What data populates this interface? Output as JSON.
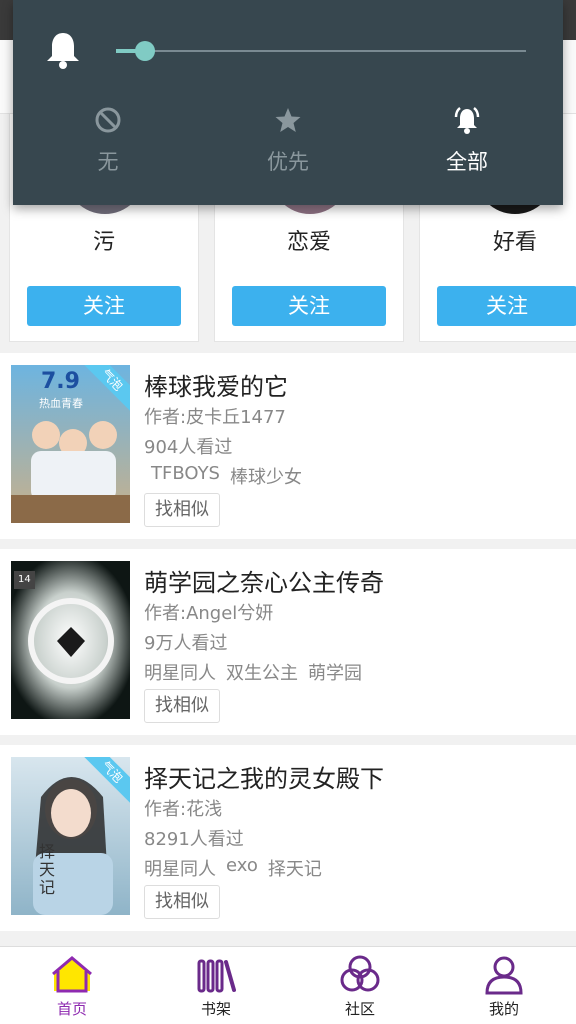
{
  "notification_mode": {
    "volume_fraction": 0.07,
    "options": [
      {
        "label": "无",
        "icon": "block-icon",
        "selected": false
      },
      {
        "label": "优先",
        "icon": "star-icon",
        "selected": false
      },
      {
        "label": "全部",
        "icon": "bell-ring-icon",
        "selected": true
      }
    ]
  },
  "tags": [
    {
      "name": "污",
      "follow_label": "关注"
    },
    {
      "name": "恋爱",
      "follow_label": "关注"
    },
    {
      "name": "好看",
      "follow_label": "关注"
    }
  ],
  "books": [
    {
      "title": "棒球我爱的它",
      "author": "作者:皮卡丘1477",
      "views": "904人看过",
      "tags": [
        "TFBOYS",
        "棒球少女"
      ],
      "similar_label": "找相似",
      "badge": "气泡",
      "cover_text": "7.9",
      "cover_subtitle": "热血青春",
      "cover_color_top": "#6db4e0",
      "cover_color_bottom": "#c9b08a"
    },
    {
      "title": "萌学园之奈心公主传奇",
      "author": "作者:Angel兮妍",
      "views": "9万人看过",
      "tags": [
        "明星同人",
        "双生公主",
        "萌学园"
      ],
      "similar_label": "找相似",
      "badge": "14",
      "cover_color_top": "#1e2a28",
      "cover_color_bottom": "#0c1412"
    },
    {
      "title": "择天记之我的灵女殿下",
      "author": "作者:花浅",
      "views": "8291人看过",
      "tags": [
        "明星同人",
        "exo",
        "择天记"
      ],
      "similar_label": "找相似",
      "badge": "气泡",
      "cover_text": "择天记",
      "cover_color_top": "#d8e6ee",
      "cover_color_bottom": "#8fb4c8"
    }
  ],
  "bottom_nav": [
    {
      "label": "首页",
      "icon": "home-icon",
      "active": true
    },
    {
      "label": "书架",
      "icon": "bookshelf-icon",
      "active": false
    },
    {
      "label": "社区",
      "icon": "community-icon",
      "active": false
    },
    {
      "label": "我的",
      "icon": "profile-icon",
      "active": false
    }
  ],
  "colors": {
    "accent": "#8e2ab0",
    "follow": "#3cb1ee",
    "overlay": "#37474f",
    "slider": "#80cbc4"
  }
}
